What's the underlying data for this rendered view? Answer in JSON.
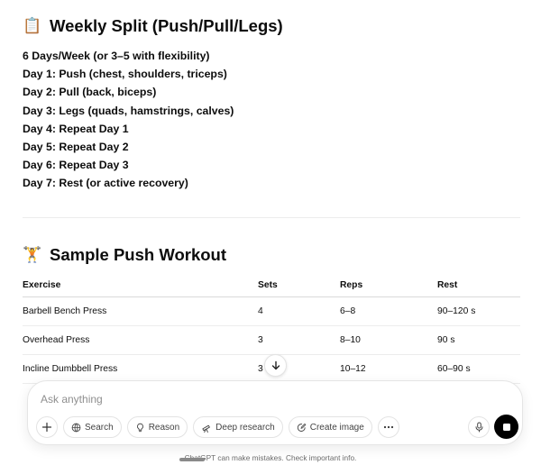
{
  "section1": {
    "emoji": "📋",
    "title": "Weekly Split (Push/Pull/Legs)",
    "lines": [
      "6 Days/Week (or 3–5 with flexibility)",
      "Day 1: Push (chest, shoulders, triceps)",
      "Day 2: Pull (back, biceps)",
      "Day 3: Legs (quads, hamstrings, calves)",
      "Day 4: Repeat Day 1",
      "Day 5: Repeat Day 2",
      "Day 6: Repeat Day 3",
      "Day 7: Rest (or active recovery)"
    ]
  },
  "section2": {
    "emoji": "🏋",
    "title": "Sample Push Workout",
    "table": {
      "headers": [
        "Exercise",
        "Sets",
        "Reps",
        "Rest"
      ],
      "rows": [
        [
          "Barbell Bench Press",
          "4",
          "6–8",
          "90–120 s"
        ],
        [
          "Overhead Press",
          "3",
          "8–10",
          "90 s"
        ],
        [
          "Incline Dumbbell Press",
          "3",
          "10–12",
          "60–90 s"
        ]
      ]
    }
  },
  "composer": {
    "placeholder": "Ask anything",
    "tools": {
      "search": "Search",
      "reason": "Reason",
      "deep_research": "Deep research",
      "create_image": "Create image"
    }
  },
  "footer": "ChatGPT can make mistakes. Check important info.",
  "colors": {
    "text": "#0d0d0d",
    "muted": "#8f8f8f",
    "stop_button": "#000000"
  }
}
